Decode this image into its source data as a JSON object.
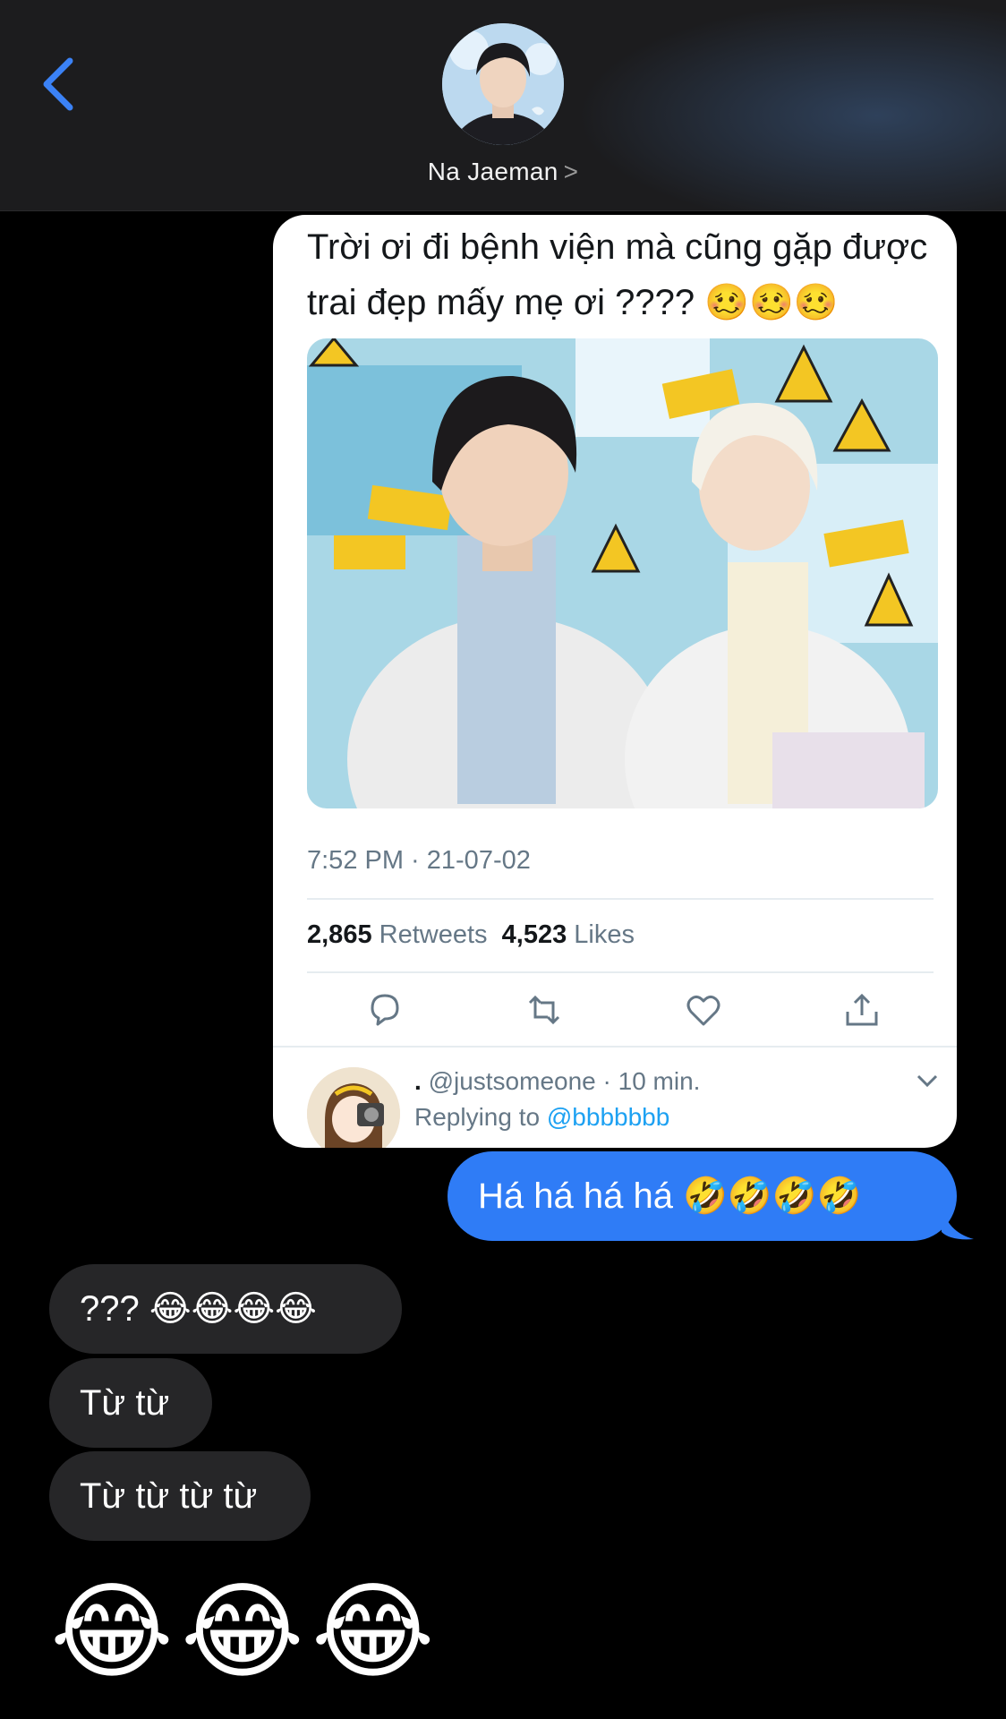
{
  "header": {
    "contact_name": "Na Jaeman",
    "name_chevron": ">",
    "back_icon": "chevron-left-icon"
  },
  "tweet": {
    "text": "Trời ơi đi bệnh viện mà cũng gặp được trai đẹp mấy mẹ ơi ???? 🥴🥴🥴",
    "timestamp": "7:52 PM · 21-07-02",
    "retweets_count": "2,865",
    "retweets_label": "Retweets",
    "likes_count": "4,523",
    "likes_label": "Likes",
    "actions": [
      "reply-icon",
      "retweet-icon",
      "like-icon",
      "share-icon"
    ],
    "reply": {
      "name": ".",
      "handle": "@justsomeone · 10 min.",
      "replying_prefix": "Replying to",
      "replying_handle": "@bbbbbbb"
    }
  },
  "messages": [
    {
      "from": "me",
      "text": "Há há há há 🤣🤣🤣🤣"
    },
    {
      "from": "them",
      "text": "??? 😂😂😂😂"
    },
    {
      "from": "them",
      "text": "Từ từ"
    },
    {
      "from": "them",
      "text": "Từ từ từ từ"
    },
    {
      "from": "them",
      "text": "😂😂😂"
    }
  ],
  "colors": {
    "sent_bubble": "#2f7cf6",
    "received_bubble": "#262628",
    "accent": "#2f7cf6",
    "twitter_link": "#1da1f2"
  }
}
